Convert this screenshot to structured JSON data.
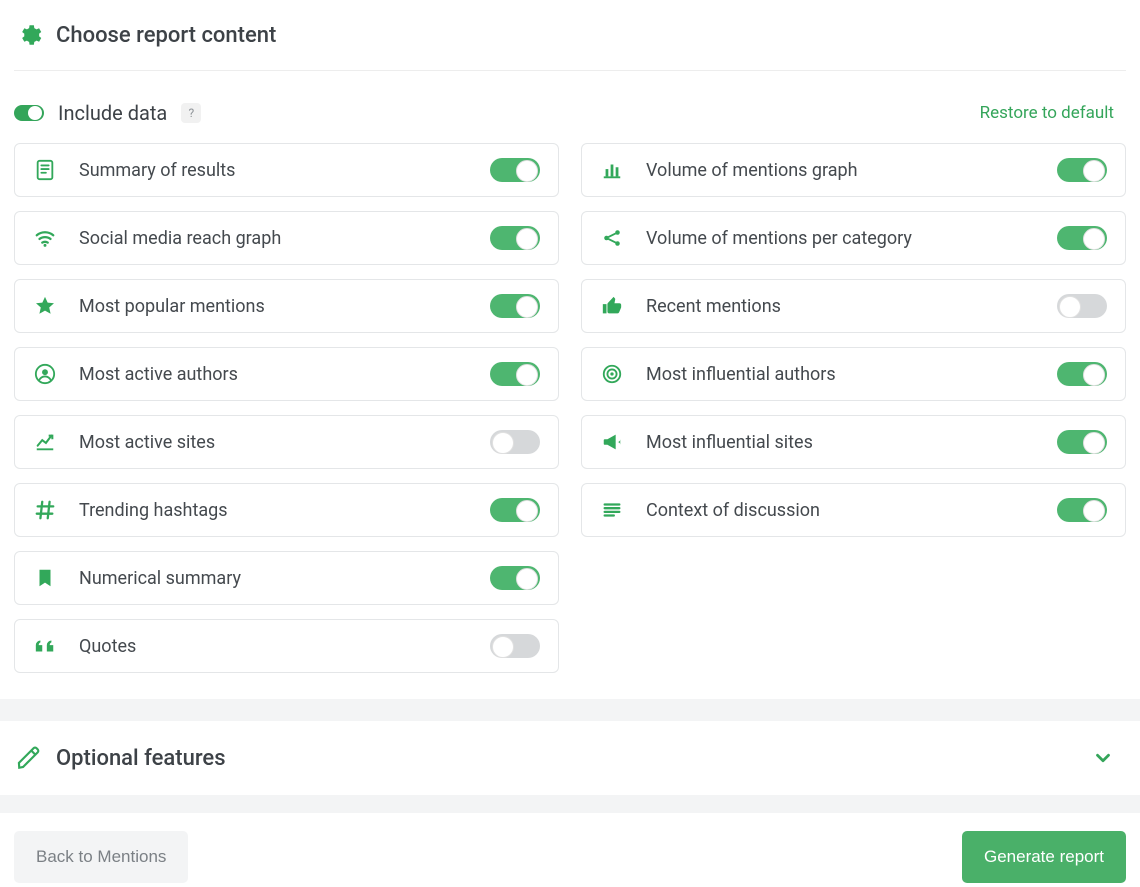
{
  "colors": {
    "accent": "#34a55a",
    "toggleOn": "#4eb670",
    "toggleOff": "#d6d8da"
  },
  "header": {
    "title": "Choose report content"
  },
  "includeData": {
    "masterOn": true,
    "label": "Include data",
    "help": "?",
    "restore": "Restore to default"
  },
  "cards": {
    "left": [
      {
        "id": "summary",
        "icon": "document-icon",
        "label": "Summary of results",
        "on": true
      },
      {
        "id": "social-reach",
        "icon": "wifi-icon",
        "label": "Social media reach graph",
        "on": true
      },
      {
        "id": "popular-mentions",
        "icon": "star-icon",
        "label": "Most popular mentions",
        "on": true
      },
      {
        "id": "active-authors",
        "icon": "user-circle-icon",
        "label": "Most active authors",
        "on": true
      },
      {
        "id": "active-sites",
        "icon": "line-chart-icon",
        "label": "Most active sites",
        "on": false
      },
      {
        "id": "trending-hashtags",
        "icon": "hash-icon",
        "label": "Trending hashtags",
        "on": true
      },
      {
        "id": "numerical-summary",
        "icon": "bookmark-icon",
        "label": "Numerical summary",
        "on": true
      },
      {
        "id": "quotes",
        "icon": "quote-icon",
        "label": "Quotes",
        "on": false
      }
    ],
    "right": [
      {
        "id": "volume-graph",
        "icon": "bar-chart-icon",
        "label": "Volume of mentions graph",
        "on": true
      },
      {
        "id": "volume-category",
        "icon": "share-icon",
        "label": "Volume of mentions per category",
        "on": true
      },
      {
        "id": "recent-mentions",
        "icon": "thumb-up-icon",
        "label": "Recent mentions",
        "on": false
      },
      {
        "id": "influential-authors",
        "icon": "target-icon",
        "label": "Most influential authors",
        "on": true
      },
      {
        "id": "influential-sites",
        "icon": "megaphone-icon",
        "label": "Most influential sites",
        "on": true
      },
      {
        "id": "context",
        "icon": "list-icon",
        "label": "Context of discussion",
        "on": true
      }
    ]
  },
  "optional": {
    "title": "Optional features",
    "expanded": false
  },
  "footer": {
    "back": "Back to Mentions",
    "generate": "Generate report"
  }
}
